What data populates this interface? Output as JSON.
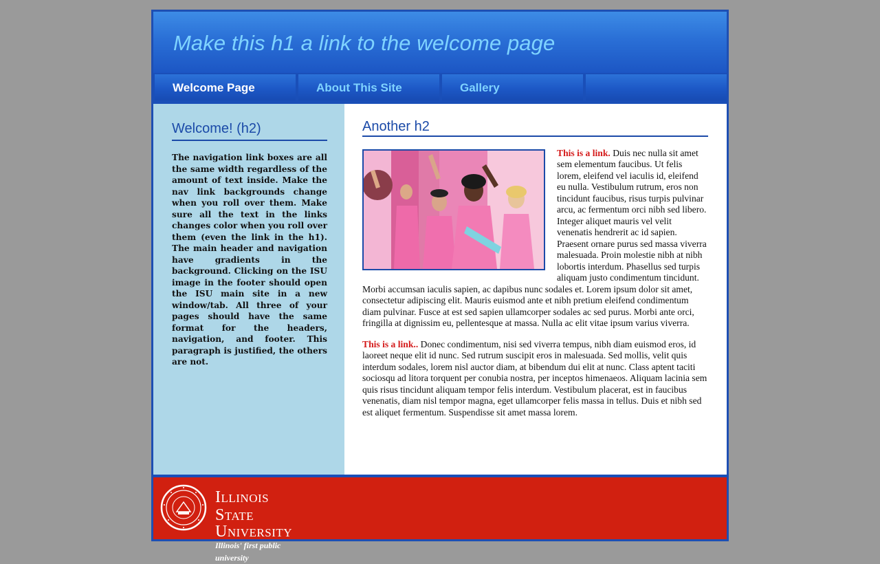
{
  "header": {
    "title": "Make this h1 a link to the welcome page"
  },
  "nav": {
    "items": [
      {
        "label": "Welcome Page"
      },
      {
        "label": "About This Site"
      },
      {
        "label": "Gallery"
      },
      {
        "label": ""
      }
    ]
  },
  "sidebar": {
    "heading": "Welcome! (h2)",
    "paragraph": "The navigation link boxes are all the same width regardless of the amount of text inside. Make the nav link backgrounds change when you roll over them. Make sure all the text in the links changes color when you roll over them (even the link in the h1). The main header and navigation have gradients in the background. Clicking on the ISU image in the footer should open the ISU main site in a new window/tab. All three of your pages should have the same format for the headers, navigation, and footer. This paragraph is justified, the others are not."
  },
  "main": {
    "heading": "Another h2",
    "p1_link": "This is a link.",
    "p1_text": " Duis nec nulla sit amet sem elementum faucibus. Ut felis lorem, eleifend vel iaculis id, eleifend eu nulla. Vestibulum rutrum, eros non tincidunt faucibus, risus turpis pulvinar arcu, ac fermentum orci nibh sed libero. Integer aliquet mauris vel velit venenatis hendrerit ac id sapien. Praesent ornare purus sed massa viverra malesuada. Proin molestie nibh at nibh lobortis interdum. Phasellus sed turpis aliquam justo condimentum tincidunt. Morbi accumsan iaculis sapien, ac dapibus nunc sodales et. Lorem ipsum dolor sit amet, consectetur adipiscing elit. Mauris euismod ante et nibh pretium eleifend condimentum diam pulvinar. Fusce at est sed sapien ullamcorper sodales ac sed purus. Morbi ante orci, fringilla at dignissim eu, pellentesque at massa. Nulla ac elit vitae ipsum varius viverra.",
    "p2_link": "This is a link..",
    "p2_text": " Donec condimentum, nisi sed viverra tempus, nibh diam euismod eros, id laoreet neque elit id nunc. Sed rutrum suscipit eros in malesuada. Sed mollis, velit quis interdum sodales, lorem nisl auctor diam, at bibendum dui elit at nunc. Class aptent taciti sociosqu ad litora torquent per conubia nostra, per inceptos himenaeos. Aliquam lacinia sem quis risus tincidunt aliquam tempor felis interdum. Vestibulum placerat, est in faucibus venenatis, diam nisl tempor magna, eget ullamcorper felis massa in tellus. Duis et nibh sed est aliquet fermentum. Suspendisse sit amet massa lorem."
  },
  "footer": {
    "line1": "Illinois State",
    "line2": "University",
    "tagline": "Illinois' first public university"
  },
  "colors": {
    "page_border": "#1e4fb3",
    "header_text": "#7fd3ff",
    "sidebar_bg": "#aed7e8",
    "heading": "#1b4aa8",
    "link_red": "#d41a1a",
    "footer_red": "#d12010"
  }
}
